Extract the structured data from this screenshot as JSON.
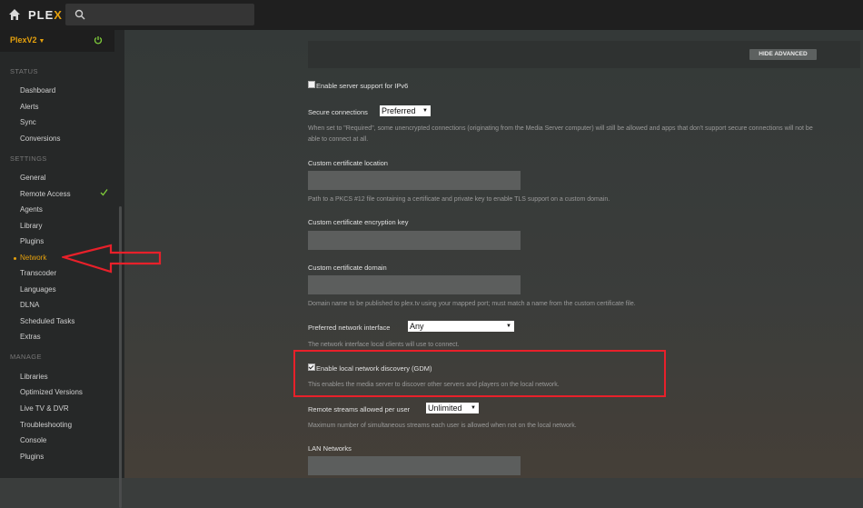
{
  "app": {
    "logo_text_a": "PLE",
    "logo_text_b": "X"
  },
  "search": {
    "placeholder": ""
  },
  "sidebar": {
    "server_name": "PlexV2",
    "sections": [
      {
        "title": "STATUS",
        "items": [
          "Dashboard",
          "Alerts",
          "Sync",
          "Conversions"
        ]
      },
      {
        "title": "SETTINGS",
        "items": [
          "General",
          "Remote Access",
          "Agents",
          "Library",
          "Plugins",
          "Network",
          "Transcoder",
          "Languages",
          "DLNA",
          "Scheduled Tasks",
          "Extras"
        ]
      },
      {
        "title": "MANAGE",
        "items": [
          "Libraries",
          "Optimized Versions",
          "Live TV & DVR",
          "Troubleshooting",
          "Console",
          "Plugins"
        ]
      }
    ],
    "active_item": "Network"
  },
  "main": {
    "hide_advanced_label": "HIDE ADVANCED",
    "ipv6_label": "Enable server support for IPv6",
    "secure_connections": {
      "label": "Secure connections",
      "value": "Preferred",
      "help": "When set to \"Required\", some unencrypted connections (originating from the Media Server computer) will still be allowed and apps that don't support secure connections will not be able to connect at all."
    },
    "cert_location": {
      "label": "Custom certificate location",
      "help": "Path to a PKCS #12 file containing a certificate and private key to enable TLS support on a custom domain."
    },
    "cert_key": {
      "label": "Custom certificate encryption key"
    },
    "cert_domain": {
      "label": "Custom certificate domain",
      "help": "Domain name to be published to plex.tv using your mapped port; must match a name from the custom certificate file."
    },
    "network_interface": {
      "label": "Preferred network interface",
      "value": "Any",
      "help": "The network interface local clients will use to connect."
    },
    "gdm": {
      "label": "Enable local network discovery (GDM)",
      "help": "This enables the media server to discover other servers and players on the local network.",
      "checked": true
    },
    "remote_streams": {
      "label": "Remote streams allowed per user",
      "value": "Unlimited",
      "help": "Maximum number of simultaneous streams each user is allowed when not on the local network."
    },
    "lan_networks": {
      "label": "LAN Networks"
    }
  },
  "colors": {
    "accent": "#e5a00d",
    "highlight": "#e8202a",
    "status_ok": "#7fcc3a"
  }
}
